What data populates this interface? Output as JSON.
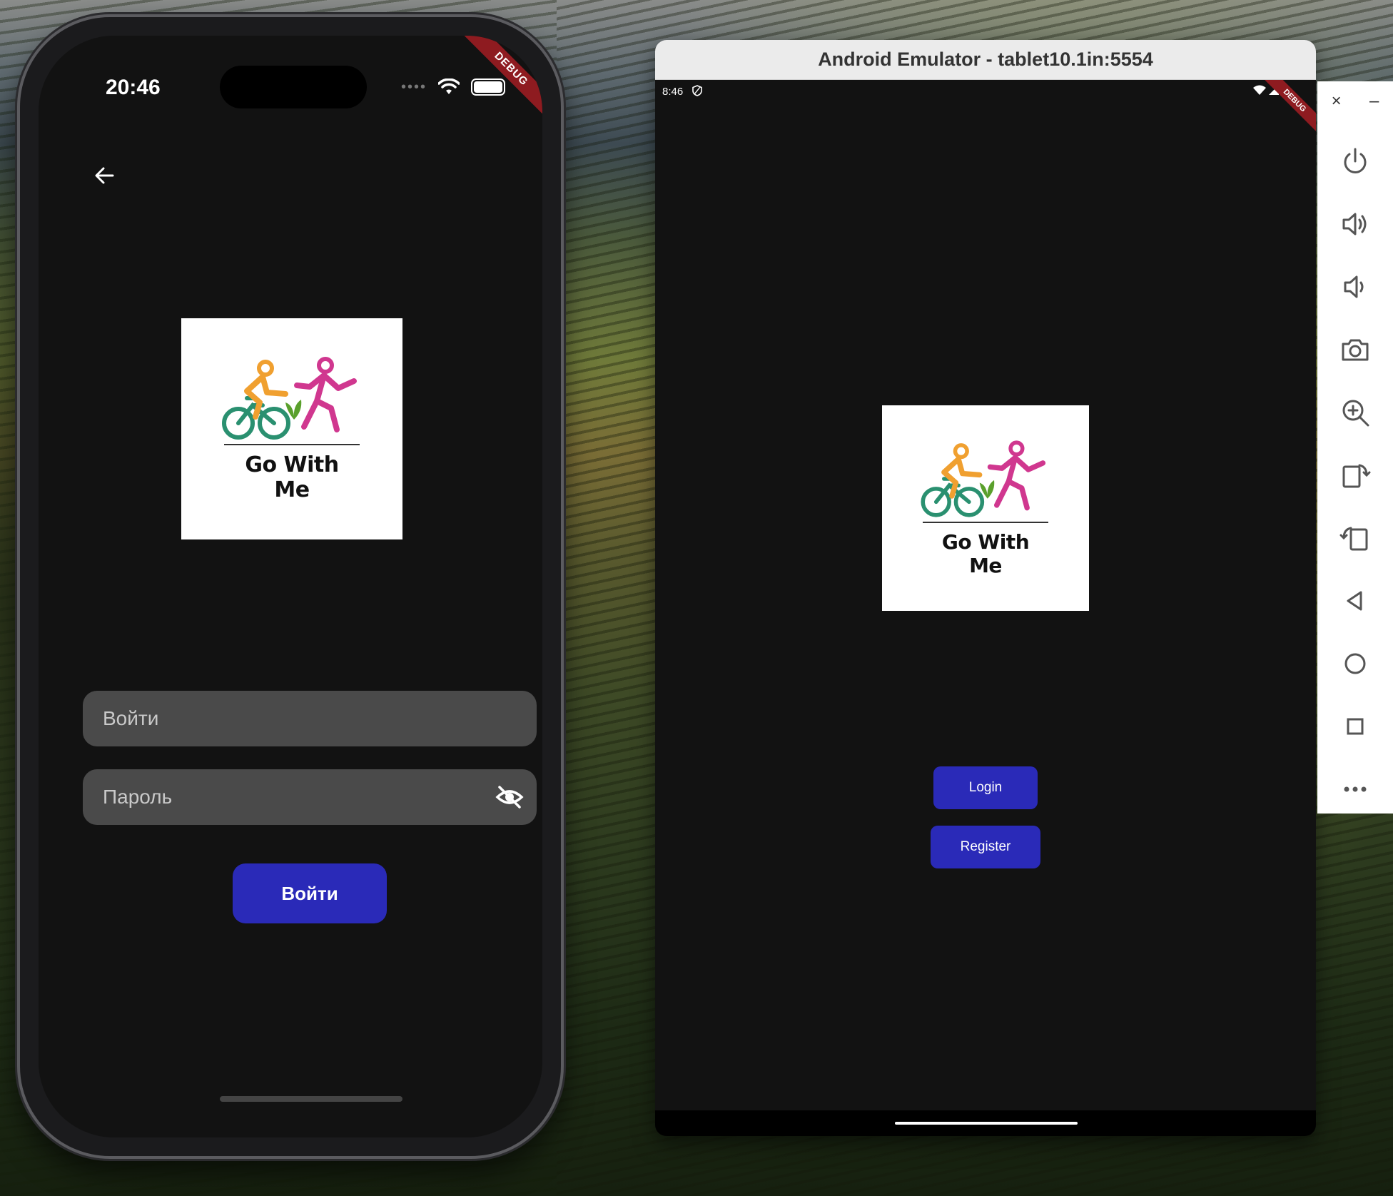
{
  "phone": {
    "time": "20:46",
    "debug_label": "DEBUG",
    "logo_text": "Go With Me",
    "login_placeholder": "Войти",
    "password_placeholder": "Пароль",
    "login_button": "Войти"
  },
  "emulator": {
    "window_title": "Android Emulator - tablet10.1in:5554",
    "time": "8:46",
    "debug_label": "DEBUG",
    "logo_text": "Go With Me",
    "login_button": "Login",
    "register_button": "Register",
    "sidebar": {
      "close": "×",
      "minimize": "–",
      "items": [
        "power-icon",
        "volume-up-icon",
        "volume-down-icon",
        "camera-icon",
        "zoom-icon",
        "rotate-right-icon",
        "rotate-left-icon",
        "back-icon",
        "home-icon",
        "overview-icon",
        "more-icon"
      ]
    }
  },
  "colors": {
    "app_bg": "#121212",
    "input_bg": "#4a4a4a",
    "primary_button": "#2a2ab8",
    "logo_orange": "#f0a030",
    "logo_teal": "#2a9070",
    "logo_magenta": "#d0378f",
    "logo_green": "#5aa02c",
    "debug_red": "#8e1b20"
  }
}
